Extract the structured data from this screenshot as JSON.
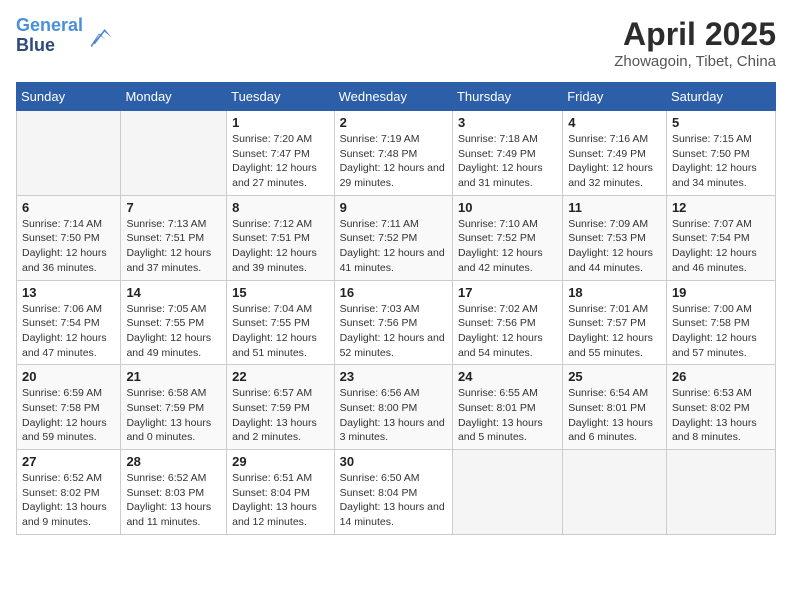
{
  "header": {
    "logo_line1": "General",
    "logo_line2": "Blue",
    "month_title": "April 2025",
    "location": "Zhowagoin, Tibet, China"
  },
  "weekdays": [
    "Sunday",
    "Monday",
    "Tuesday",
    "Wednesday",
    "Thursday",
    "Friday",
    "Saturday"
  ],
  "weeks": [
    [
      null,
      null,
      {
        "day": 1,
        "sunrise": "7:20 AM",
        "sunset": "7:47 PM",
        "daylight": "12 hours and 27 minutes."
      },
      {
        "day": 2,
        "sunrise": "7:19 AM",
        "sunset": "7:48 PM",
        "daylight": "12 hours and 29 minutes."
      },
      {
        "day": 3,
        "sunrise": "7:18 AM",
        "sunset": "7:49 PM",
        "daylight": "12 hours and 31 minutes."
      },
      {
        "day": 4,
        "sunrise": "7:16 AM",
        "sunset": "7:49 PM",
        "daylight": "12 hours and 32 minutes."
      },
      {
        "day": 5,
        "sunrise": "7:15 AM",
        "sunset": "7:50 PM",
        "daylight": "12 hours and 34 minutes."
      }
    ],
    [
      {
        "day": 6,
        "sunrise": "7:14 AM",
        "sunset": "7:50 PM",
        "daylight": "12 hours and 36 minutes."
      },
      {
        "day": 7,
        "sunrise": "7:13 AM",
        "sunset": "7:51 PM",
        "daylight": "12 hours and 37 minutes."
      },
      {
        "day": 8,
        "sunrise": "7:12 AM",
        "sunset": "7:51 PM",
        "daylight": "12 hours and 39 minutes."
      },
      {
        "day": 9,
        "sunrise": "7:11 AM",
        "sunset": "7:52 PM",
        "daylight": "12 hours and 41 minutes."
      },
      {
        "day": 10,
        "sunrise": "7:10 AM",
        "sunset": "7:52 PM",
        "daylight": "12 hours and 42 minutes."
      },
      {
        "day": 11,
        "sunrise": "7:09 AM",
        "sunset": "7:53 PM",
        "daylight": "12 hours and 44 minutes."
      },
      {
        "day": 12,
        "sunrise": "7:07 AM",
        "sunset": "7:54 PM",
        "daylight": "12 hours and 46 minutes."
      }
    ],
    [
      {
        "day": 13,
        "sunrise": "7:06 AM",
        "sunset": "7:54 PM",
        "daylight": "12 hours and 47 minutes."
      },
      {
        "day": 14,
        "sunrise": "7:05 AM",
        "sunset": "7:55 PM",
        "daylight": "12 hours and 49 minutes."
      },
      {
        "day": 15,
        "sunrise": "7:04 AM",
        "sunset": "7:55 PM",
        "daylight": "12 hours and 51 minutes."
      },
      {
        "day": 16,
        "sunrise": "7:03 AM",
        "sunset": "7:56 PM",
        "daylight": "12 hours and 52 minutes."
      },
      {
        "day": 17,
        "sunrise": "7:02 AM",
        "sunset": "7:56 PM",
        "daylight": "12 hours and 54 minutes."
      },
      {
        "day": 18,
        "sunrise": "7:01 AM",
        "sunset": "7:57 PM",
        "daylight": "12 hours and 55 minutes."
      },
      {
        "day": 19,
        "sunrise": "7:00 AM",
        "sunset": "7:58 PM",
        "daylight": "12 hours and 57 minutes."
      }
    ],
    [
      {
        "day": 20,
        "sunrise": "6:59 AM",
        "sunset": "7:58 PM",
        "daylight": "12 hours and 59 minutes."
      },
      {
        "day": 21,
        "sunrise": "6:58 AM",
        "sunset": "7:59 PM",
        "daylight": "13 hours and 0 minutes."
      },
      {
        "day": 22,
        "sunrise": "6:57 AM",
        "sunset": "7:59 PM",
        "daylight": "13 hours and 2 minutes."
      },
      {
        "day": 23,
        "sunrise": "6:56 AM",
        "sunset": "8:00 PM",
        "daylight": "13 hours and 3 minutes."
      },
      {
        "day": 24,
        "sunrise": "6:55 AM",
        "sunset": "8:01 PM",
        "daylight": "13 hours and 5 minutes."
      },
      {
        "day": 25,
        "sunrise": "6:54 AM",
        "sunset": "8:01 PM",
        "daylight": "13 hours and 6 minutes."
      },
      {
        "day": 26,
        "sunrise": "6:53 AM",
        "sunset": "8:02 PM",
        "daylight": "13 hours and 8 minutes."
      }
    ],
    [
      {
        "day": 27,
        "sunrise": "6:52 AM",
        "sunset": "8:02 PM",
        "daylight": "13 hours and 9 minutes."
      },
      {
        "day": 28,
        "sunrise": "6:52 AM",
        "sunset": "8:03 PM",
        "daylight": "13 hours and 11 minutes."
      },
      {
        "day": 29,
        "sunrise": "6:51 AM",
        "sunset": "8:04 PM",
        "daylight": "13 hours and 12 minutes."
      },
      {
        "day": 30,
        "sunrise": "6:50 AM",
        "sunset": "8:04 PM",
        "daylight": "13 hours and 14 minutes."
      },
      null,
      null,
      null
    ]
  ],
  "labels": {
    "sunrise": "Sunrise:",
    "sunset": "Sunset:",
    "daylight": "Daylight:"
  }
}
